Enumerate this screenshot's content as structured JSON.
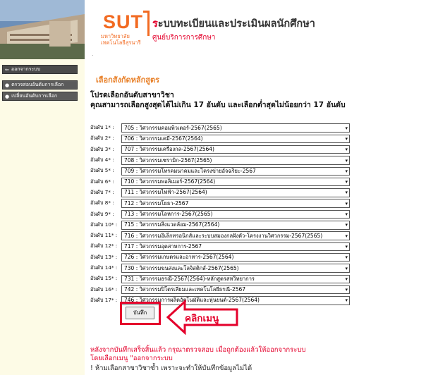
{
  "header": {
    "logo_text": "SUT",
    "logo_th_line1": "มหาวิทยาลัย",
    "logo_th_line2": "เทคโนโลยีสุรนารี",
    "title_first_letter": "ร",
    "title_rest": "ะบบทะเบียนและประเมินผลนักศึกษา",
    "subtitle": "ศูนย์บริการการศึกษา",
    "dot": "."
  },
  "sidebar": {
    "back_label": "ออกจากระบบ",
    "items": [
      {
        "label": "ตรวจสอบอันดับการเลือก"
      },
      {
        "label": "เปลี่ยนอันดับการเลือก"
      }
    ]
  },
  "main": {
    "section_title": "เลือกสังกัดหลักสูตร",
    "instruction_line1": "โปรดเลือกอันดับสาขาวิชา",
    "instruction_line2": "คุณสามารถเลือกสูงสุดได้ไม่เกิน 17 อันดับ และเลือกต่ำสุดไม่น้อยกว่า 17 อันดับ"
  },
  "rankings": [
    {
      "label": "อันดับ 1* :",
      "value": "705 : วิศวกรรมคอมพิวเตอร์-2567(2565)"
    },
    {
      "label": "อันดับ 2* :",
      "value": "706 : วิศวกรรมเคมี-2567(2564)"
    },
    {
      "label": "อันดับ 3* :",
      "value": "707 : วิศวกรรมเครื่องกล-2567(2564)"
    },
    {
      "label": "อันดับ 4* :",
      "value": "708 : วิศวกรรมเซรามิก-2567(2565)"
    },
    {
      "label": "อันดับ 5* :",
      "value": "709 : วิศวกรรมโทรคมนาคมและโครงข่ายอัจฉริยะ-2567"
    },
    {
      "label": "อันดับ 6* :",
      "value": "710 : วิศวกรรมพอลิเมอร์-2567(2564)"
    },
    {
      "label": "อันดับ 7* :",
      "value": "711 : วิศวกรรมไฟฟ้า-2567(2564)"
    },
    {
      "label": "อันดับ 8* :",
      "value": "712 : วิศวกรรมโยธา-2567"
    },
    {
      "label": "อันดับ 9* :",
      "value": "713 : วิศวกรรมโลหการ-2567(2565)"
    },
    {
      "label": "อันดับ 10* :",
      "value": "715 : วิศวกรรมสิ่งแวดล้อม-2567(2564)"
    },
    {
      "label": "อันดับ 11* :",
      "value": "716 : วิศวกรรมอิเล็กทรอนิกส์และระบบสมองกลฝังตัว-โครงงานวิศวกรรม-2567(2565)"
    },
    {
      "label": "อันดับ 12* :",
      "value": "717 : วิศวกรรมอุตสาหการ-2567"
    },
    {
      "label": "อันดับ 13* :",
      "value": "726 : วิศวกรรมเกษตรและอาหาร-2567(2564)"
    },
    {
      "label": "อันดับ 14* :",
      "value": "730 : วิศวกรรมขนส่งและโลจิสติกส์-2567(2565)"
    },
    {
      "label": "อันดับ 15* :",
      "value": "731 : วิศวกรรมธรณี-2567(2564)-หลักสูตรสหวิทยาการ"
    },
    {
      "label": "อันดับ 16* :",
      "value": "742 : วิศวกรรมปิโตรเลียมและเทคโนโลยีธรณี-2567"
    },
    {
      "label": "อันดับ 17* :",
      "value": "746 : วิศวกรรมการผลิตอัตโนมัติและหุ่นยนต์-2567(2564)"
    }
  ],
  "save_button_label": "บันทึก",
  "annotation": {
    "label": "คลิกเมนู"
  },
  "notes": {
    "line1": "หลังจากบันทึกเสร็จสิ้นแล้ว กรุณาตรวจสอบ เมื่อถูกต้องแล้วให้ออกจากระบบ",
    "line2": "โดยเลือกเมนู \"ออกจากระบบ",
    "line3": "! ห้ามเลือกสาขาวิชาซ้ำ เพราะจะทำให้บันทึกข้อมูลไม่ได้"
  },
  "colors": {
    "brand_orange": "#f26a21",
    "highlight_red": "#e4002b",
    "section_orange": "#e8812a",
    "sidebar_bg": "#fdfbe6"
  }
}
